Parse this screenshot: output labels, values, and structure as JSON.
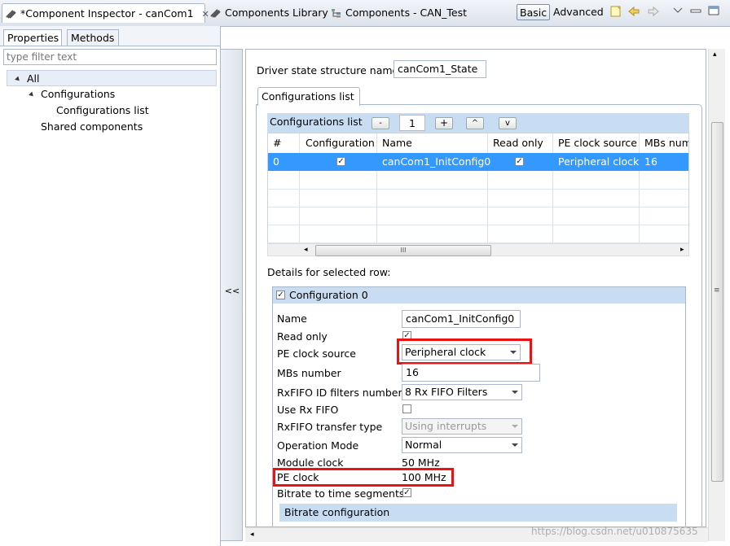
{
  "tabs": {
    "inspector": "*Component Inspector - canCom1",
    "library": "Components Library",
    "components": "Components - CAN_Test",
    "basic": "Basic",
    "advanced": "Advanced"
  },
  "left": {
    "tab_properties": "Properties",
    "tab_methods": "Methods",
    "filter_placeholder": "type filter text",
    "tree": [
      "All",
      "Configurations",
      "Configurations list",
      "Shared components"
    ]
  },
  "splitter_label": "<<",
  "form": {
    "driver_label": "Driver state structure name",
    "driver_value": "canCom1_State",
    "tab_label": "Configurations list",
    "list_title": "Configurations list",
    "btn_minus": "-",
    "counter": "1",
    "btn_plus": "+",
    "btn_up": "^",
    "btn_down": "v",
    "columns": [
      "#",
      "Configuration",
      "Name",
      "Read only",
      "PE clock source",
      "MBs num"
    ],
    "row": {
      "index": "0",
      "name": "canCom1_InitConfig0",
      "pe_clock": "Peripheral clock",
      "mbs": "16"
    },
    "hscroll_label": "III",
    "details_label": "Details for selected row:",
    "group_title": "Configuration 0",
    "fields": {
      "name_label": "Name",
      "name_value": "canCom1_InitConfig0",
      "readonly_label": "Read only",
      "pe_source_label": "PE clock source",
      "pe_source_value": "Peripheral clock",
      "mbs_label": "MBs number",
      "mbs_value": "16",
      "rxfifo_id_label": "RxFIFO ID filters number",
      "rxfifo_id_value": "8 Rx FIFO Filters",
      "use_rxfifo_label": "Use Rx FIFO",
      "rxfifo_transfer_label": "RxFIFO transfer type",
      "rxfifo_transfer_value": "Using interrupts",
      "op_mode_label": "Operation Mode",
      "op_mode_value": "Normal",
      "module_clock_label": "Module clock",
      "module_clock_value": "50 MHz",
      "pe_clock_label": "PE clock",
      "pe_clock_value": "100 MHz",
      "bitrate_seg_label": "Bitrate to time segments",
      "bitrate_config_label": "Bitrate configuration"
    }
  },
  "watermark": "https://blog.csdn.net/u010875635",
  "colors": {
    "highlight": "#ee1111",
    "selection": "#3399ff",
    "header": "#c9ddf2"
  }
}
